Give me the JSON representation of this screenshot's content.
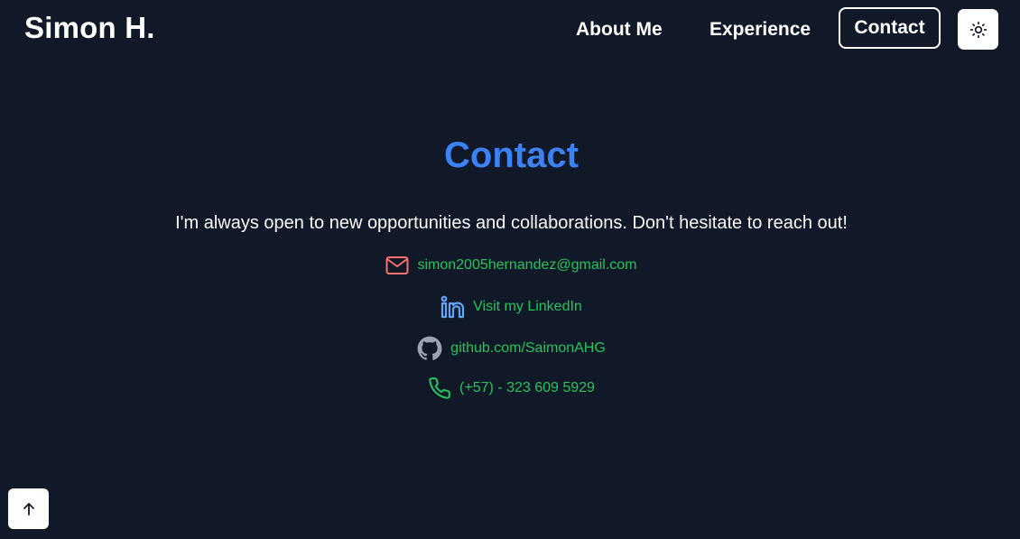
{
  "header": {
    "brand": "Simon H.",
    "nav": {
      "about": "About Me",
      "experience": "Experience",
      "contact": "Contact"
    },
    "theme_toggle_icon": "sun-icon"
  },
  "contact_section": {
    "title": "Contact",
    "intro": "I'm always open to new opportunities and collaborations. Don't hesitate to reach out!",
    "items": {
      "email": {
        "icon": "mail-icon",
        "text": "simon2005hernandez@gmail.com",
        "icon_color": "#f87171"
      },
      "linkedin": {
        "icon": "linkedin-icon",
        "text": "Visit my LinkedIn",
        "icon_color": "#60a5fa"
      },
      "github": {
        "icon": "github-icon",
        "text": "github.com/SaimonAHG",
        "icon_color": "#9ca3af"
      },
      "phone": {
        "icon": "phone-icon",
        "text": "(+57) - 323 609 5929",
        "icon_color": "#22c55e"
      }
    }
  },
  "scroll_top": {
    "icon": "arrow-up-icon"
  },
  "colors": {
    "background": "#111827",
    "accent_title": "#3b82f6",
    "link": "#22c55e"
  }
}
